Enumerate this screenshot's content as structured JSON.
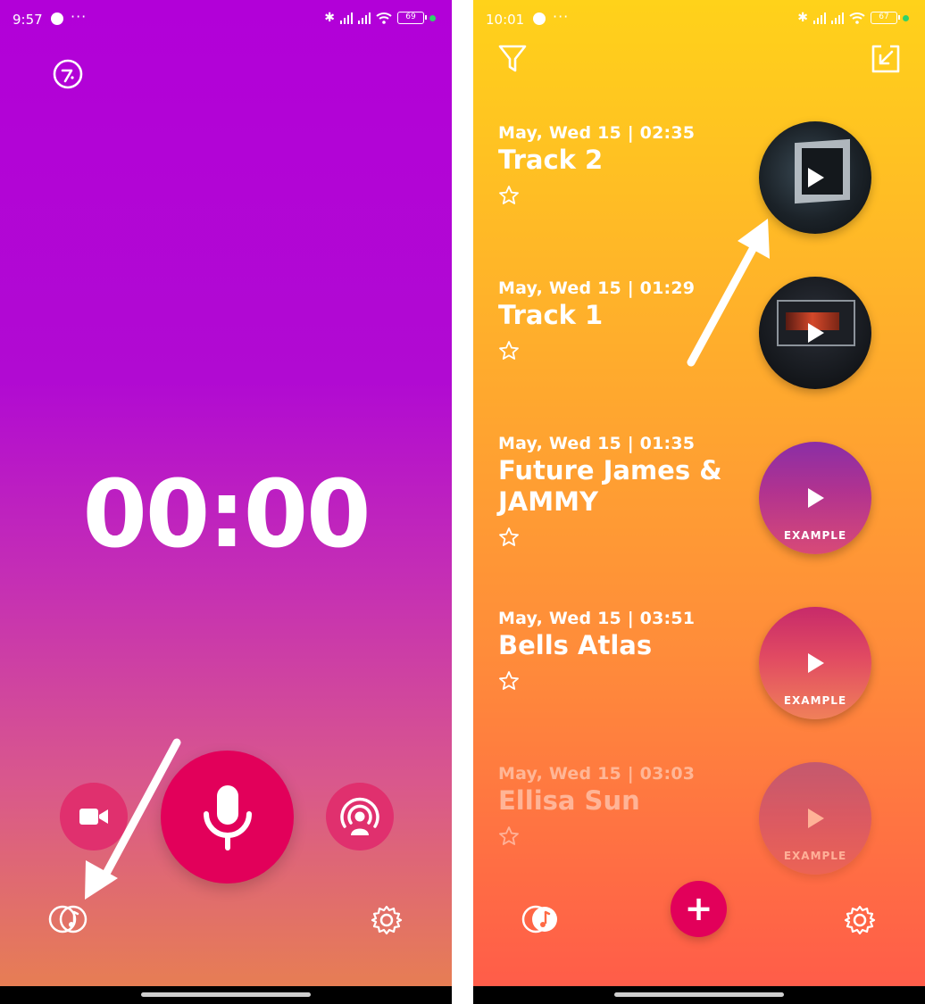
{
  "left": {
    "status": {
      "time": "9:57",
      "battery": "69"
    },
    "timer": "00:00"
  },
  "right": {
    "status": {
      "time": "10:01",
      "battery": "67"
    },
    "recordings": [
      {
        "date": "May, Wed 15 | 02:35",
        "title": "Track 2",
        "badge": ""
      },
      {
        "date": "May, Wed 15 | 01:29",
        "title": "Track 1",
        "badge": ""
      },
      {
        "date": "May, Wed 15 | 01:35",
        "title": "Future James & JAMMY",
        "badge": "EXAMPLE"
      },
      {
        "date": "May, Wed 15 | 03:51",
        "title": "Bells Atlas",
        "badge": "EXAMPLE"
      },
      {
        "date": "May, Wed 15 | 03:03",
        "title": "Ellisa Sun",
        "badge": "EXAMPLE"
      }
    ],
    "add_label": "+"
  },
  "colors": {
    "left_bg_top": "#b200d8",
    "left_bg_bottom": "#e8814f",
    "right_bg_top": "#ffd21a",
    "right_bg_bottom": "#ff5a4a",
    "accent": "#e2005a",
    "accent_light": "#e0306e"
  },
  "icons": [
    "metronome-icon",
    "video-camera-icon",
    "microphone-icon",
    "live-broadcast-icon",
    "library-icon",
    "settings-gear-icon",
    "filter-icon",
    "import-icon",
    "star-icon",
    "play-icon",
    "plus-icon"
  ]
}
